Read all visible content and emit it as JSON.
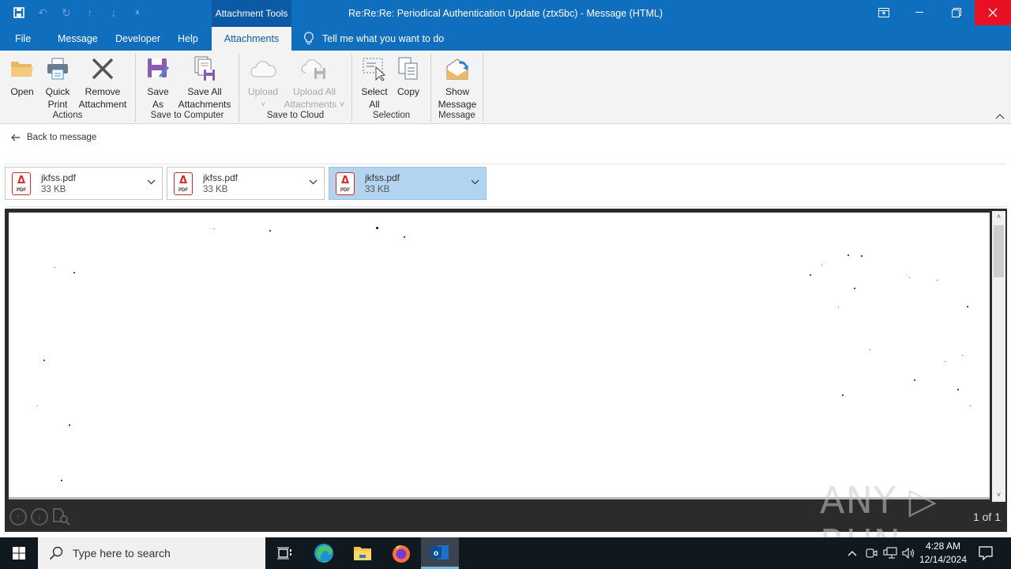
{
  "window": {
    "title": "Re:Re:Re:  Periodical Authentication Update (ztx5bc)  -  Message (HTML)",
    "context_tab_group": "Attachment Tools",
    "controls": {
      "ribbon_display": "ribbon-display-icon",
      "minimize": "minimize-icon",
      "restore": "restore-icon",
      "close": "close-icon"
    }
  },
  "quick_access": [
    {
      "name": "save-icon"
    },
    {
      "name": "undo-icon"
    },
    {
      "name": "redo-icon"
    },
    {
      "name": "previous-item-icon"
    },
    {
      "name": "next-item-icon"
    },
    {
      "name": "customize-qat-icon"
    }
  ],
  "menu_tabs": [
    {
      "label": "File"
    },
    {
      "label": "Message"
    },
    {
      "label": "Developer"
    },
    {
      "label": "Help"
    },
    {
      "label": "Attachments",
      "active": true
    }
  ],
  "tell_me": "Tell me what you want to do",
  "ribbon": {
    "groups": [
      {
        "label": "Actions",
        "buttons": [
          {
            "line1": "Open",
            "line2": "",
            "icon": "open-folder-icon"
          },
          {
            "line1": "Quick",
            "line2": "Print",
            "icon": "printer-icon"
          },
          {
            "line1": "Remove",
            "line2": "Attachment",
            "icon": "remove-x-icon"
          }
        ]
      },
      {
        "label": "Save to Computer",
        "buttons": [
          {
            "line1": "Save",
            "line2": "As",
            "icon": "save-as-icon"
          },
          {
            "line1": "Save All",
            "line2": "Attachments",
            "icon": "save-all-icon"
          }
        ]
      },
      {
        "label": "Save to Cloud",
        "buttons": [
          {
            "line1": "Upload",
            "line2": "˅",
            "icon": "cloud-upload-icon",
            "disabled": true
          },
          {
            "line1": "Upload All",
            "line2": "Attachments ˅",
            "icon": "cloud-upload-all-icon",
            "disabled": true
          }
        ]
      },
      {
        "label": "Selection",
        "buttons": [
          {
            "line1": "Select",
            "line2": "All",
            "icon": "select-all-icon"
          },
          {
            "line1": "Copy",
            "line2": "",
            "icon": "copy-icon"
          }
        ]
      },
      {
        "label": "Message",
        "buttons": [
          {
            "line1": "Show",
            "line2": "Message",
            "icon": "show-message-icon"
          }
        ]
      }
    ]
  },
  "back_link": "Back to message",
  "attachments": [
    {
      "name": "jkfss.pdf",
      "size": "33 KB",
      "type": "PDF",
      "selected": false
    },
    {
      "name": "jkfss.pdf",
      "size": "33 KB",
      "type": "PDF",
      "selected": false
    },
    {
      "name": "jkfss.pdf",
      "size": "33 KB",
      "type": "PDF",
      "selected": true
    }
  ],
  "preview": {
    "page_count": "1 of 1"
  },
  "watermark": "ANY ▷ RUN",
  "taskbar": {
    "search_placeholder": "Type here to search",
    "apps": [
      "task-view-icon",
      "edge-icon",
      "file-explorer-icon",
      "firefox-icon",
      "outlook-icon"
    ],
    "time": "4:28 AM",
    "date": "12/14/2024"
  }
}
